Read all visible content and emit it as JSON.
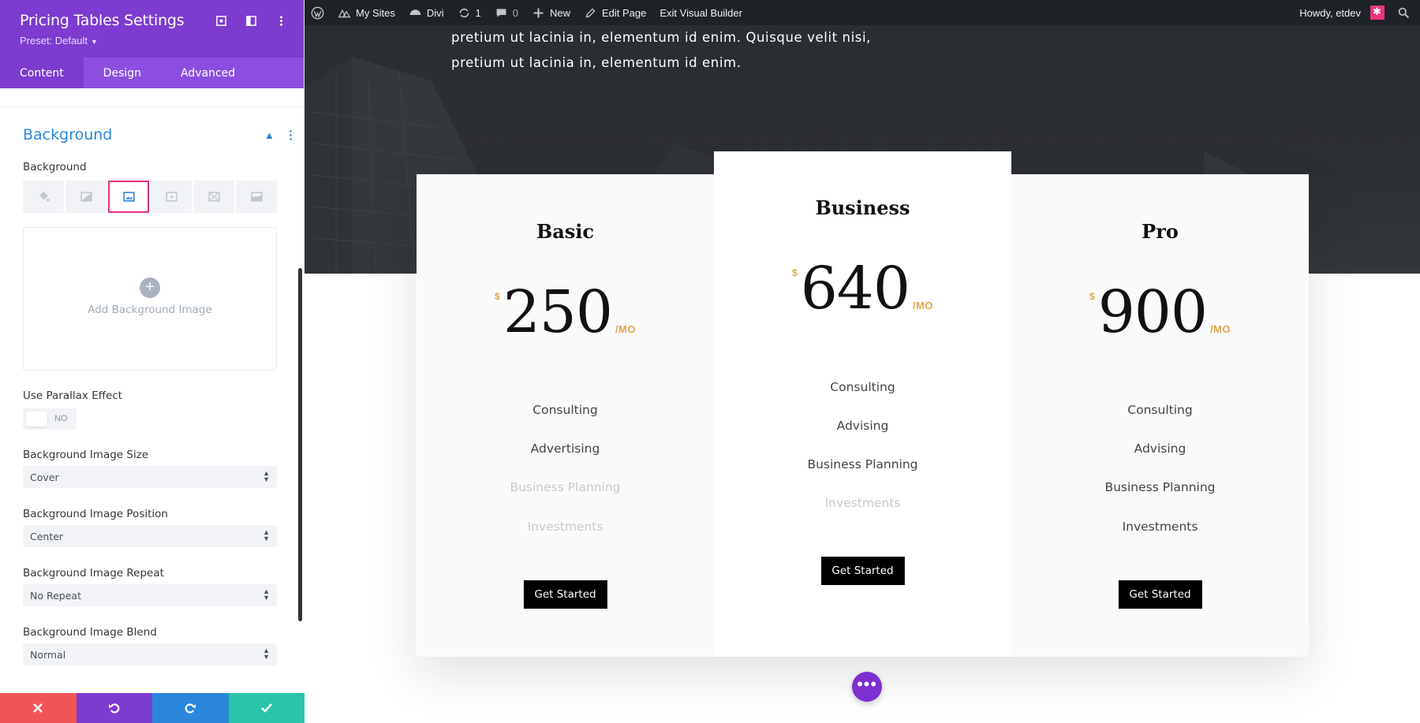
{
  "panel": {
    "title": "Pricing Tables Settings",
    "preset": "Preset: Default",
    "tabs": [
      "Content",
      "Design",
      "Advanced"
    ],
    "active_tab": "Content",
    "section_title": "Background",
    "background_label": "Background",
    "background_tabs": [
      "color-icon",
      "gradient-icon",
      "image-icon",
      "video-icon",
      "pattern-icon",
      "mask-icon"
    ],
    "active_background_tab": "image-icon",
    "add_image_label": "Add Background Image",
    "parallax_label": "Use Parallax Effect",
    "parallax_value": "NO",
    "size_label": "Background Image Size",
    "size_value": "Cover",
    "position_label": "Background Image Position",
    "position_value": "Center",
    "repeat_label": "Background Image Repeat",
    "repeat_value": "No Repeat",
    "blend_label": "Background Image Blend",
    "blend_value": "Normal",
    "footer_colors": {
      "discard": "#ef5555",
      "undo": "#7d3bcf",
      "redo": "#2b87da",
      "save": "#29c4a9"
    }
  },
  "adminbar": {
    "my_sites": "My Sites",
    "divi": "Divi",
    "updates": "1",
    "comments": "0",
    "new": "New",
    "edit_page": "Edit Page",
    "exit_builder": "Exit Visual Builder",
    "howdy": "Howdy, etdev"
  },
  "hero": {
    "line1": "pretium ut lacinia in, elementum id enim. Quisque velit nisi,",
    "line2": "pretium ut lacinia in, elementum id enim."
  },
  "pricing": [
    {
      "title": "Basic",
      "currency": "$",
      "amount": "250",
      "per": "/MO",
      "features": [
        {
          "text": "Consulting",
          "included": true
        },
        {
          "text": "Advertising",
          "included": true
        },
        {
          "text": "Business Planning",
          "included": false
        },
        {
          "text": "Investments",
          "included": false
        }
      ],
      "button": "Get Started"
    },
    {
      "title": "Business",
      "currency": "$",
      "amount": "640",
      "per": "/MO",
      "features": [
        {
          "text": "Consulting",
          "included": true
        },
        {
          "text": "Advising",
          "included": true
        },
        {
          "text": "Business Planning",
          "included": true
        },
        {
          "text": "Investments",
          "included": false
        }
      ],
      "button": "Get Started"
    },
    {
      "title": "Pro",
      "currency": "$",
      "amount": "900",
      "per": "/MO",
      "features": [
        {
          "text": "Consulting",
          "included": true
        },
        {
          "text": "Advising",
          "included": true
        },
        {
          "text": "Business Planning",
          "included": true
        },
        {
          "text": "Investments",
          "included": true
        }
      ],
      "button": "Get Started"
    }
  ],
  "accent": {
    "purple": "#7d3bcf",
    "gold": "#e0a64c",
    "blue": "#2b87da",
    "pink": "#e4317c"
  }
}
